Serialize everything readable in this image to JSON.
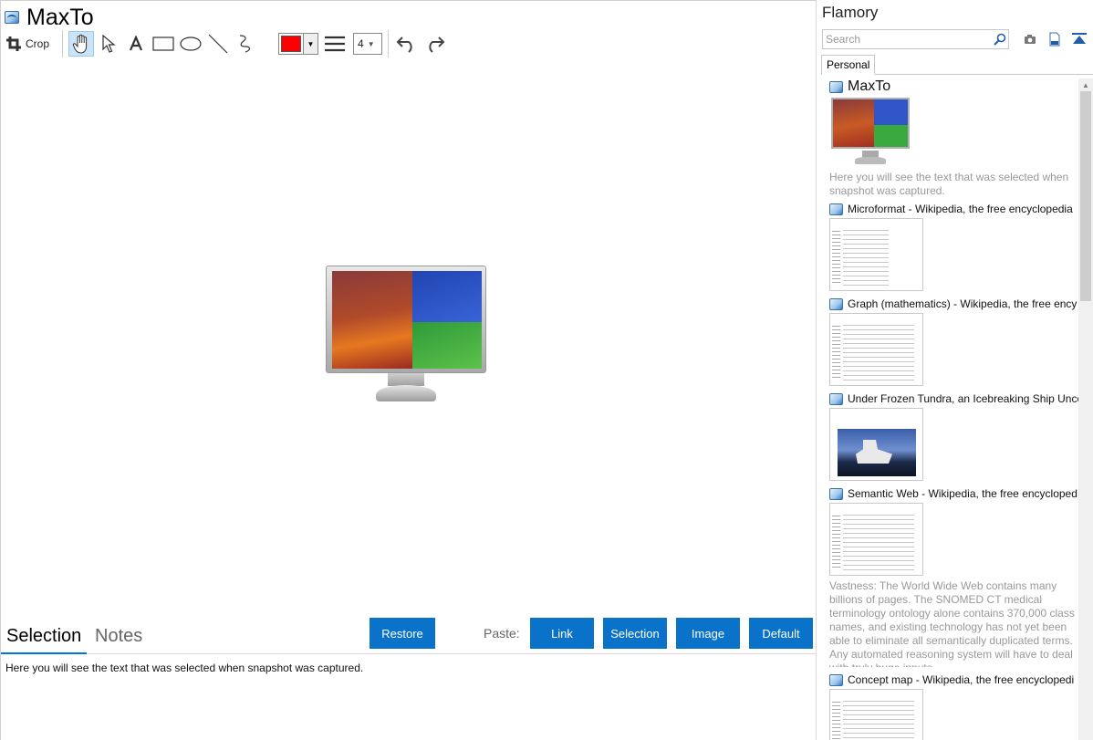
{
  "app": {
    "title": "MaxTo"
  },
  "toolbar": {
    "crop_label": "Crop",
    "line_width_value": "4",
    "color": "#ff0000",
    "icons": [
      "crop-icon",
      "hand-icon",
      "pointer-icon",
      "text-icon",
      "rectangle-icon",
      "ellipse-icon",
      "line-icon",
      "freehand-icon",
      "color-dropdown-icon",
      "line-width-icon",
      "undo-icon",
      "redo-icon"
    ]
  },
  "bottom": {
    "tabs": [
      {
        "label": "Selection",
        "active": true
      },
      {
        "label": "Notes",
        "active": false
      }
    ],
    "restore_label": "Restore",
    "paste_label": "Paste:",
    "paste_buttons": [
      "Link",
      "Selection",
      "Image",
      "Default"
    ],
    "selection_text": "Here you will see the text that was selected when snapshot was captured."
  },
  "sidebar": {
    "title": "Flamory",
    "search_placeholder": "Search",
    "tab_label": "Personal",
    "items": [
      {
        "title": "MaxTo",
        "description": "Here you will see the text that was selected when snapshot was captured."
      },
      {
        "title": "Microformat - Wikipedia, the free encyclopedia",
        "description": ""
      },
      {
        "title": "Graph (mathematics) - Wikipedia, the free ency",
        "description": ""
      },
      {
        "title": "Under Frozen Tundra, an Icebreaking Ship Unco",
        "description": ""
      },
      {
        "title": "Semantic Web - Wikipedia, the free encycloped",
        "description": "Vastness: The World Wide Web contains many billions of pages. The SNOMED CT medical terminology ontology alone contains 370,000 class names, and existing technology has not yet been able to eliminate all semantically duplicated terms. Any automated reasoning system will have to deal with truly huge inputs."
      },
      {
        "title": "Concept map - Wikipedia, the free encyclopedi",
        "description": ""
      }
    ]
  },
  "colors": {
    "accent": "#0a73c9",
    "tab_underline": "#0078d7"
  }
}
